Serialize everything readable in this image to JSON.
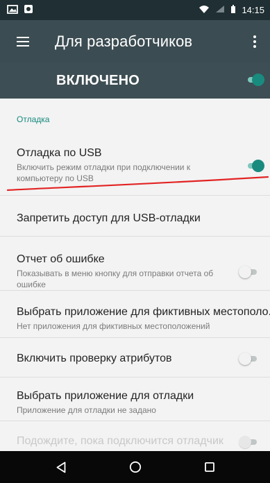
{
  "status_bar": {
    "time": "14:15",
    "icons": [
      "image-icon",
      "notification-icon",
      "wifi-icon",
      "signal-icon",
      "battery-icon"
    ]
  },
  "app_bar": {
    "title": "Для разработчиков",
    "menu_icon": "hamburger-icon",
    "more_icon": "more-vertical-icon"
  },
  "master_switch": {
    "label": "ВКЛЮЧЕНО",
    "state": "on"
  },
  "section": {
    "label": "Отладка"
  },
  "settings": [
    {
      "title": "Отладка по USB",
      "subtitle": "Включить режим отладки при подключении к компьютеру по USB",
      "toggle": "on"
    },
    {
      "title": "Запретить доступ для USB-отладки"
    },
    {
      "title": "Отчет об ошибке",
      "subtitle": "Показывать в меню кнопку для отправки отчета об ошибке",
      "toggle": "off"
    },
    {
      "title": "Выбрать приложение для фиктивных местополо..",
      "subtitle": "Нет приложения для фиктивных местоположений"
    },
    {
      "title": "Включить проверку атрибутов",
      "toggle": "off"
    },
    {
      "title": "Выбрать приложение для отладки",
      "subtitle": "Приложение для отладки не задано"
    },
    {
      "title": "Подождите, пока подключится отладчик",
      "toggle": "disabled"
    }
  ],
  "navigation": {
    "buttons": [
      "back-icon",
      "home-icon",
      "overview-icon"
    ]
  },
  "colors": {
    "status_bar": "#1f2f33",
    "app_bar": "#3b4c52",
    "accent": "#198b7e",
    "annotation": "#e32323",
    "background": "#f3f3f3"
  }
}
